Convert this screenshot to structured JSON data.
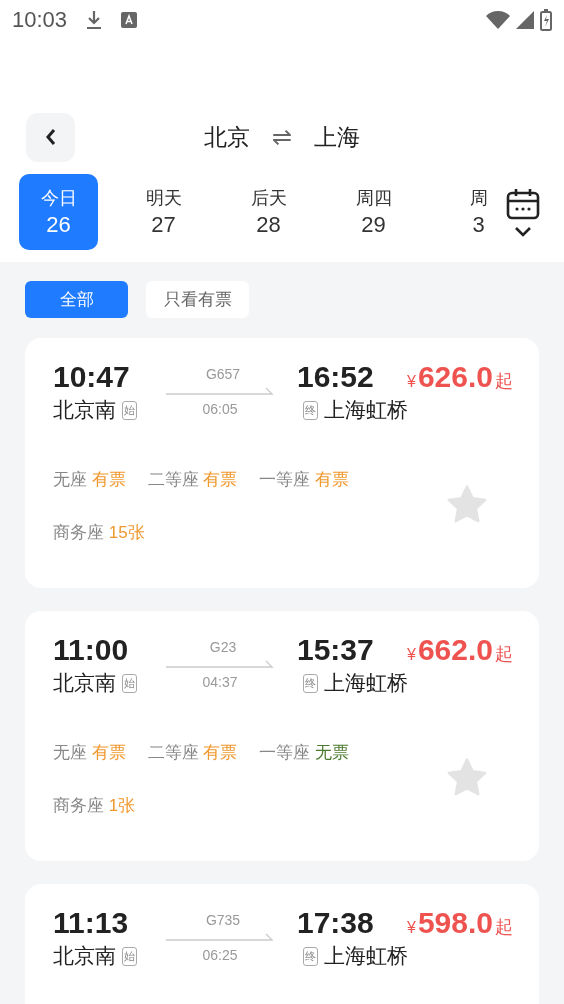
{
  "status_bar": {
    "time": "10:03"
  },
  "header": {
    "from": "北京",
    "swap": "⇌",
    "to": "上海"
  },
  "dates": [
    {
      "label": "今日",
      "day": "26",
      "selected": true
    },
    {
      "label": "明天",
      "day": "27",
      "selected": false
    },
    {
      "label": "后天",
      "day": "28",
      "selected": false
    },
    {
      "label": "周四",
      "day": "29",
      "selected": false
    },
    {
      "label": "周",
      "day": "3",
      "selected": false
    }
  ],
  "filters": [
    {
      "label": "全部",
      "selected": true
    },
    {
      "label": "只看有票",
      "selected": false
    }
  ],
  "trains": [
    {
      "depart": "10:47",
      "train_no": "G657",
      "duration": "06:05",
      "arrive": "16:52",
      "currency": "¥",
      "price": "626.0",
      "price_suffix": "起",
      "from_station": "北京南",
      "from_tag": "始",
      "to_tag": "终",
      "to_station": "上海虹桥",
      "favorite": false,
      "seats": [
        {
          "name": "无座",
          "status": "有票",
          "available": true
        },
        {
          "name": "二等座",
          "status": "有票",
          "available": true
        },
        {
          "name": "一等座",
          "status": "有票",
          "available": true
        },
        {
          "name": "商务座",
          "status": "15张",
          "available": true
        }
      ]
    },
    {
      "depart": "11:00",
      "train_no": "G23",
      "duration": "04:37",
      "arrive": "15:37",
      "currency": "¥",
      "price": "662.0",
      "price_suffix": "起",
      "from_station": "北京南",
      "from_tag": "始",
      "to_tag": "终",
      "to_station": "上海虹桥",
      "favorite": false,
      "seats": [
        {
          "name": "无座",
          "status": "有票",
          "available": true
        },
        {
          "name": "二等座",
          "status": "有票",
          "available": true
        },
        {
          "name": "一等座",
          "status": "无票",
          "available": false
        },
        {
          "name": "商务座",
          "status": "1张",
          "available": true
        }
      ]
    },
    {
      "depart": "11:13",
      "train_no": "G735",
      "duration": "06:25",
      "arrive": "17:38",
      "currency": "¥",
      "price": "598.0",
      "price_suffix": "起",
      "from_station": "北京南",
      "from_tag": "始",
      "to_tag": "终",
      "to_station": "上海虹桥"
    }
  ]
}
